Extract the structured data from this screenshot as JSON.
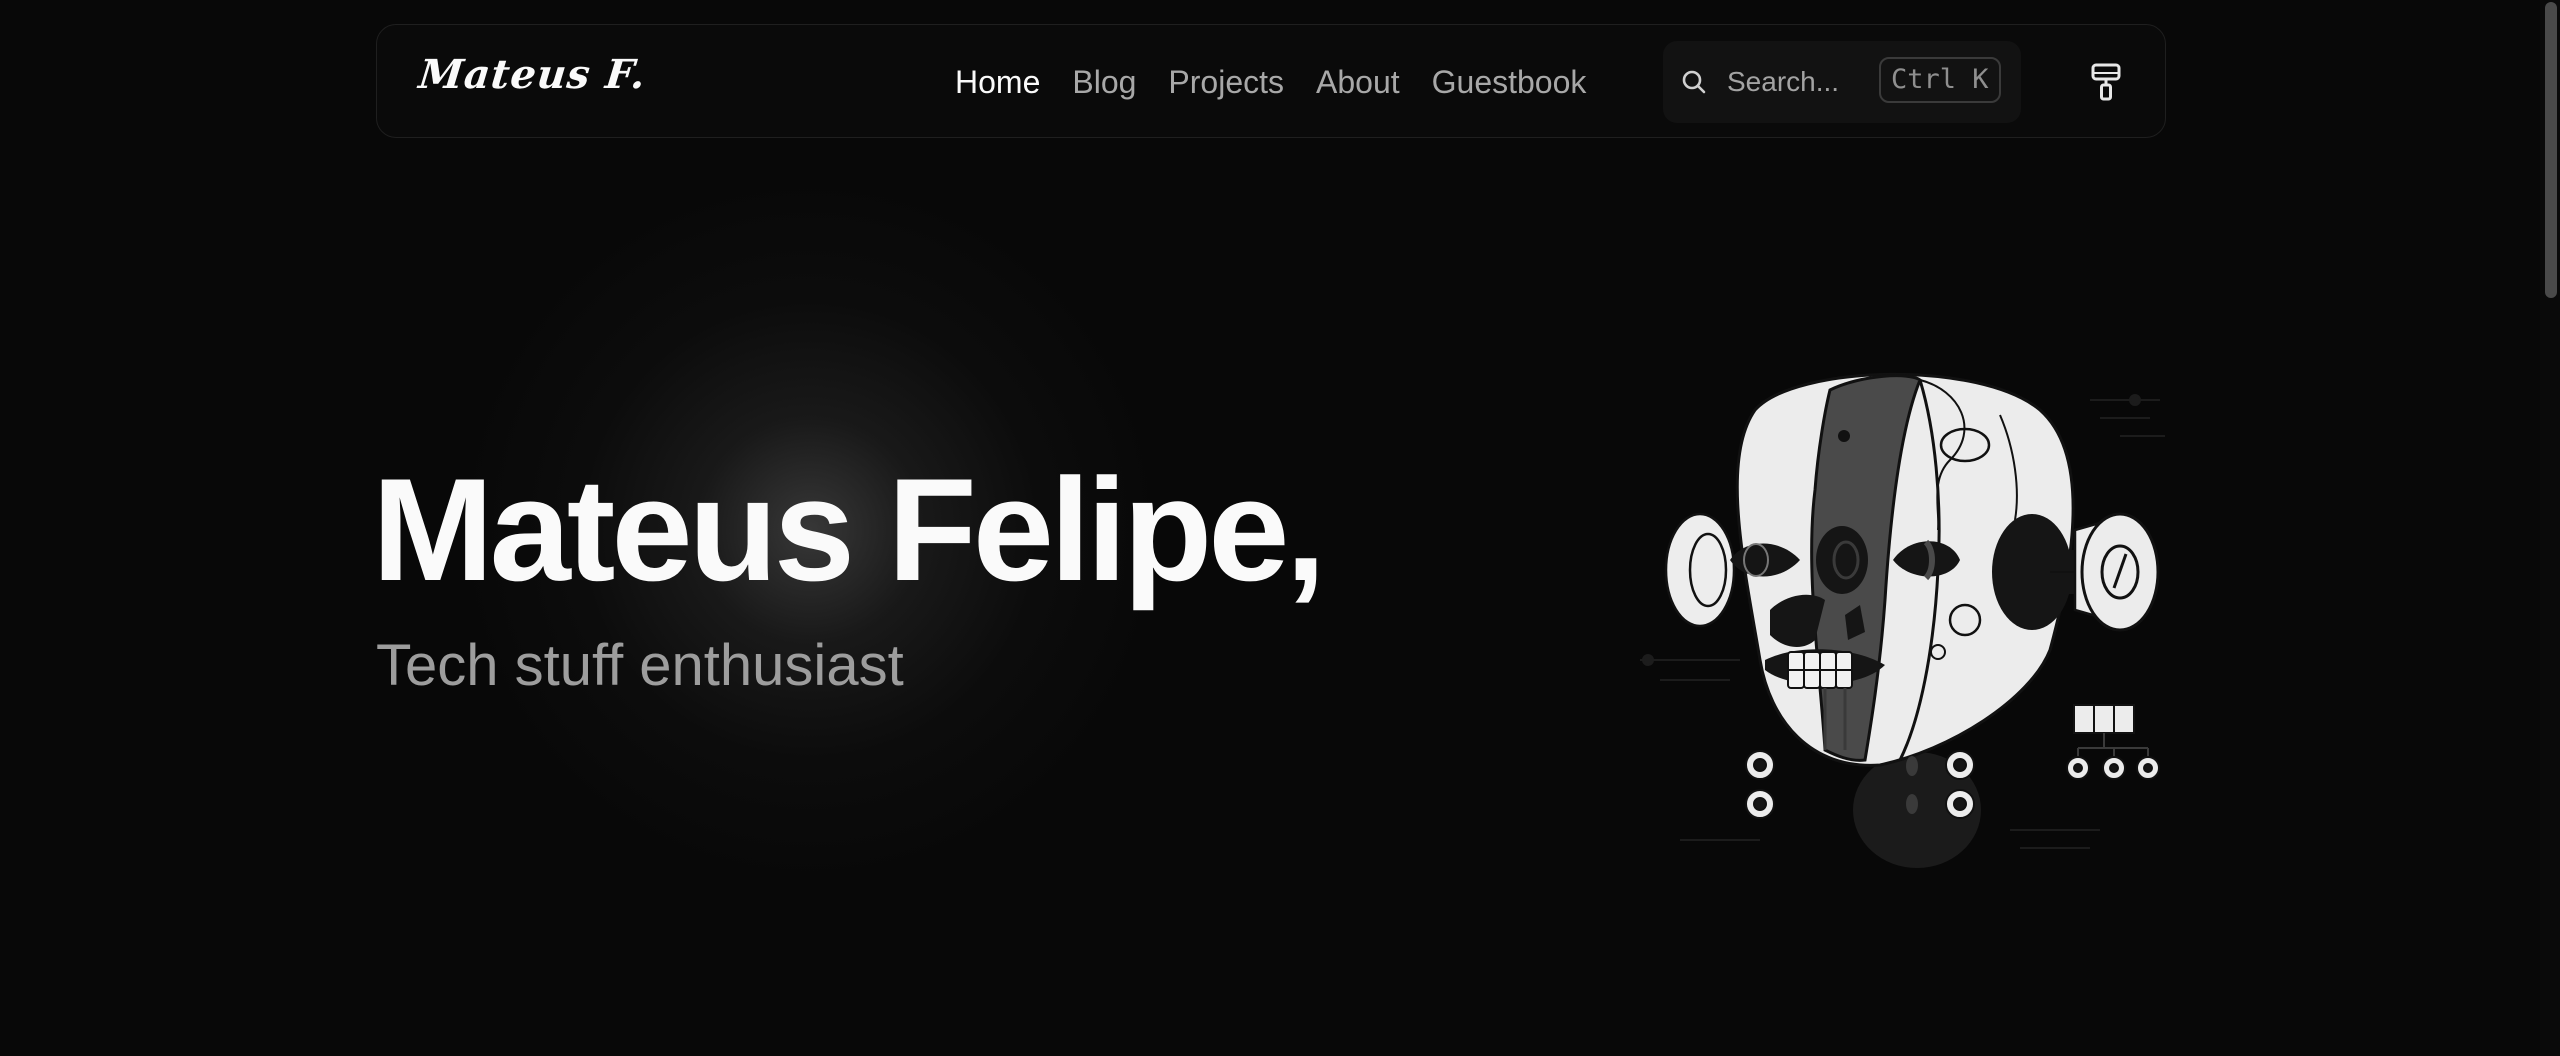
{
  "navbar": {
    "logo": "Mateus F.",
    "links": [
      {
        "label": "Home",
        "active": true
      },
      {
        "label": "Blog",
        "active": false
      },
      {
        "label": "Projects",
        "active": false
      },
      {
        "label": "About",
        "active": false
      },
      {
        "label": "Guestbook",
        "active": false
      }
    ],
    "search": {
      "placeholder": "Search...",
      "shortcut": "Ctrl K",
      "icon": "search-icon"
    },
    "theme_button": {
      "icon": "paint-roller-icon"
    }
  },
  "hero": {
    "title": "Mateus Felipe,",
    "subtitle": "Tech stuff enthusiast",
    "illustration": "robot-head-illustration"
  },
  "colors": {
    "background": "#080808",
    "text": "#fafafa",
    "muted": "#a8a8a8",
    "border": "#1f1f1f"
  }
}
